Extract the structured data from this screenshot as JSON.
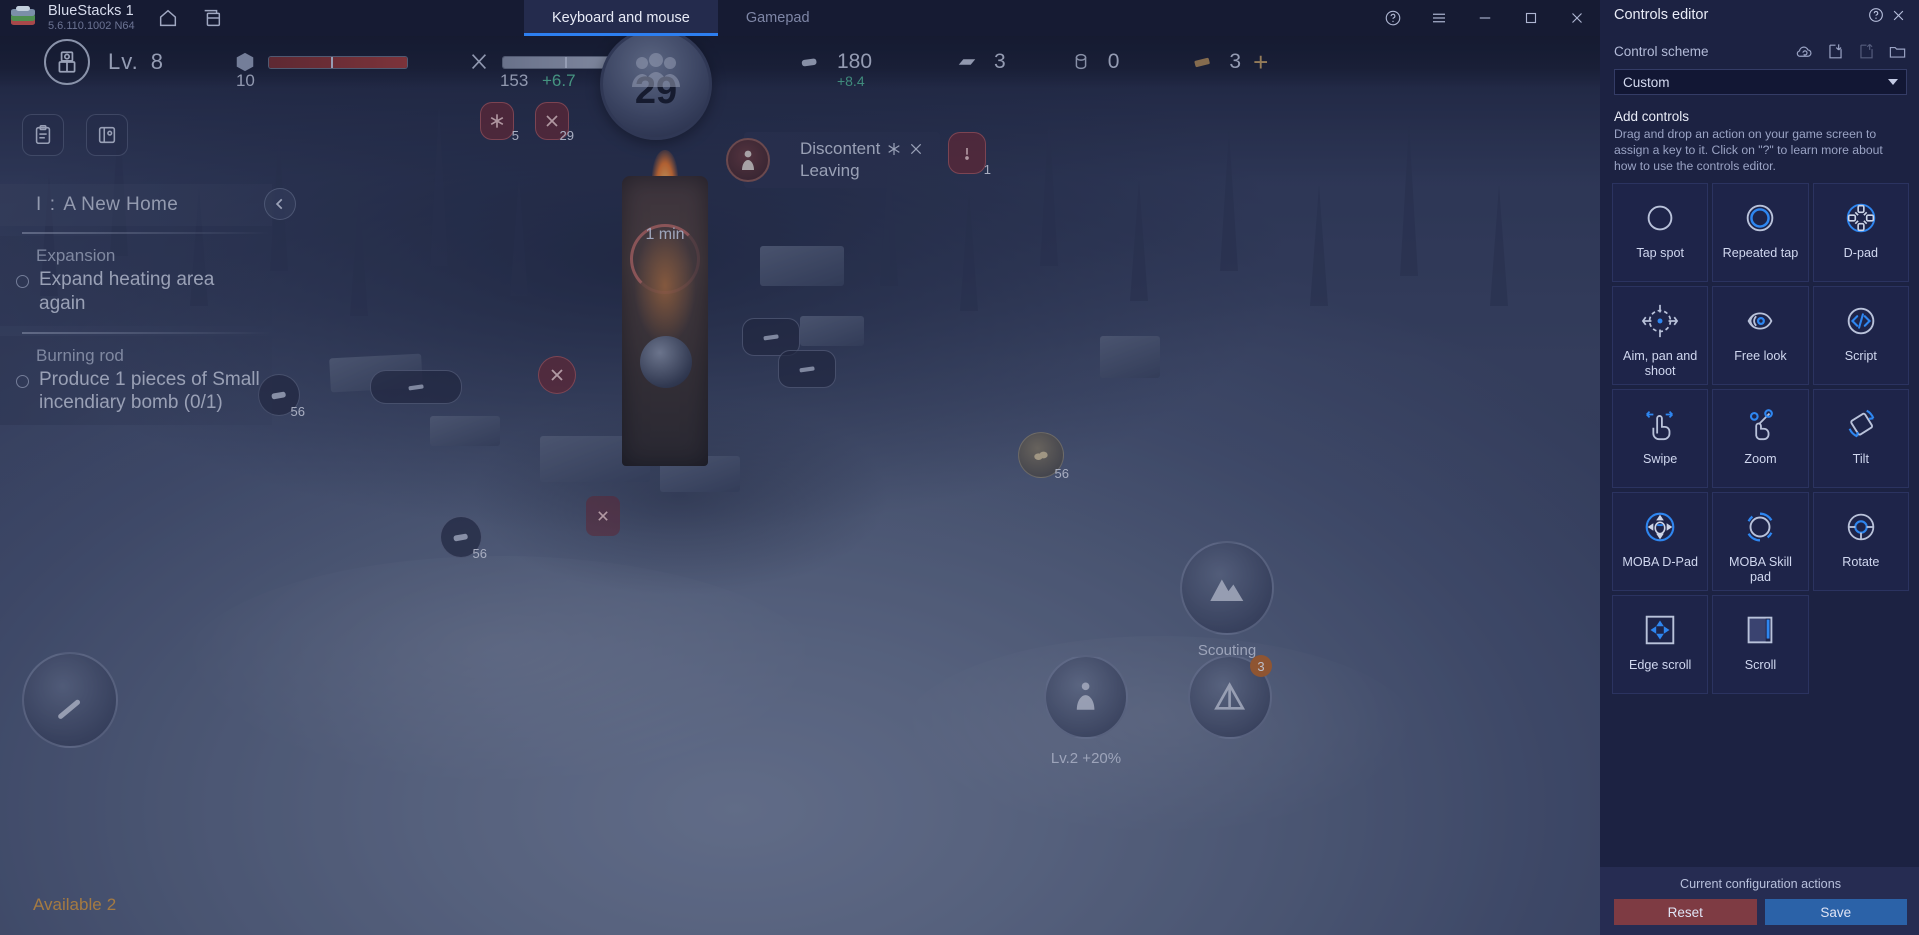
{
  "titlebar": {
    "app_name": "BlueStacks 1",
    "version": "5.6.110.1002  N64",
    "icons": [
      "home-icon",
      "multi-instance-icon"
    ],
    "tabs": [
      {
        "label": "Keyboard and mouse",
        "active": true
      },
      {
        "label": "Gamepad",
        "active": false
      }
    ],
    "window_controls": [
      "help-icon",
      "menu-icon",
      "minimize-icon",
      "maximize-icon",
      "close-icon"
    ],
    "accent_color": "#2d7ff0"
  },
  "game": {
    "hud": {
      "city_level_label": "Lv.",
      "city_level_value": "8",
      "temperature_value": "10",
      "food_value": "153",
      "food_delta": "+6.7",
      "population_value": "29",
      "coal_value": "180",
      "coal_delta": "+8.4",
      "steel_value": "3",
      "wood_value": "0",
      "crate_value": "3",
      "add_label": "+"
    },
    "quest": {
      "chapter": "I",
      "chapter_sep": ":",
      "title": "A New Home",
      "groups": [
        {
          "category": "Expansion",
          "task": "Expand heating area again"
        },
        {
          "category": "Burning rod",
          "task": "Produce 1 pieces of Small incendiary bomb (0/1)"
        }
      ]
    },
    "tooltip": {
      "line1": "Discontent",
      "line2": "Leaving"
    },
    "tower": {
      "timer": "1 min"
    },
    "markers": [
      {
        "name": "cold-marker",
        "value": "5"
      },
      {
        "name": "sick-marker",
        "value": "29"
      },
      {
        "name": "resource-marker-a",
        "value": "56"
      },
      {
        "name": "resource-marker-b",
        "value": "56"
      },
      {
        "name": "resource-marker-c",
        "value": "56"
      },
      {
        "name": "notice-marker",
        "value": "1"
      }
    ],
    "buttons": {
      "scouting": "Scouting",
      "workshop_level": "Lv.2 +20%",
      "tent_badge": "3",
      "available_label": "Available",
      "available_count": "2"
    }
  },
  "controls_editor": {
    "title": "Controls editor",
    "header_icons": [
      "help-icon",
      "close-icon"
    ],
    "scheme": {
      "label": "Control scheme",
      "icons": [
        "cloud-restore-icon",
        "import-icon",
        "export-icon",
        "folder-icon"
      ],
      "selected": "Custom"
    },
    "add_controls": {
      "title": "Add controls",
      "description": "Drag and drop an action on your game screen to assign a key to it. Click on \"?\" to learn more about how to use the controls editor."
    },
    "controls": [
      {
        "label": "Tap spot",
        "icon": "tap-spot-icon"
      },
      {
        "label": "Repeated tap",
        "icon": "repeated-tap-icon"
      },
      {
        "label": "D-pad",
        "icon": "dpad-icon"
      },
      {
        "label": "Aim, pan and shoot",
        "icon": "aim-pan-shoot-icon"
      },
      {
        "label": "Free look",
        "icon": "free-look-icon"
      },
      {
        "label": "Script",
        "icon": "script-icon"
      },
      {
        "label": "Swipe",
        "icon": "swipe-icon"
      },
      {
        "label": "Zoom",
        "icon": "zoom-icon"
      },
      {
        "label": "Tilt",
        "icon": "tilt-icon"
      },
      {
        "label": "MOBA D-Pad",
        "icon": "moba-dpad-icon"
      },
      {
        "label": "MOBA Skill pad",
        "icon": "moba-skill-pad-icon"
      },
      {
        "label": "Rotate",
        "icon": "rotate-icon"
      },
      {
        "label": "Edge scroll",
        "icon": "edge-scroll-icon"
      },
      {
        "label": "Scroll",
        "icon": "scroll-icon"
      }
    ],
    "footer": {
      "label": "Current configuration actions",
      "reset": "Reset",
      "save": "Save",
      "reset_color": "#7e3b43",
      "save_color": "#2b62a8"
    }
  }
}
